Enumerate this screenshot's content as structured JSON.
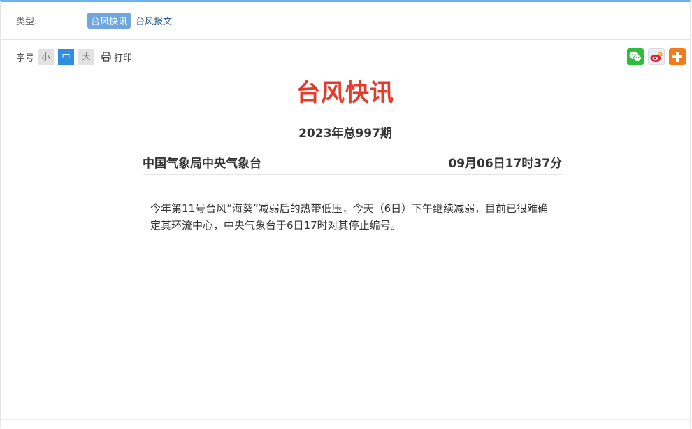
{
  "type_row": {
    "label": "类型:",
    "tabs": [
      {
        "label": "台风快讯",
        "active": true
      },
      {
        "label": "台风报文",
        "active": false
      }
    ]
  },
  "toolbar": {
    "font_size_label": "字号",
    "sizes": [
      {
        "label": "小",
        "active": false
      },
      {
        "label": "中",
        "active": true
      },
      {
        "label": "大",
        "active": false
      }
    ],
    "print_label": "打印",
    "share_icons": [
      "wechat-icon",
      "weibo-icon",
      "more-share-icon"
    ]
  },
  "article": {
    "title": "台风快讯",
    "issue": "2023年总997期",
    "publisher": "中国气象局中央气象台",
    "time": "09月06日17时37分",
    "body": "今年第11号台风“海葵”减弱后的热带低压，今天（6日）下午继续减弱，目前已很难确定其环流中心，中央气象台于6日17时对其停止编号。"
  },
  "colors": {
    "accent_top": "#6ab4f0",
    "title_red": "#e83a2a",
    "active_size": "#2f8fde",
    "active_tab": "#6fa6dd"
  }
}
